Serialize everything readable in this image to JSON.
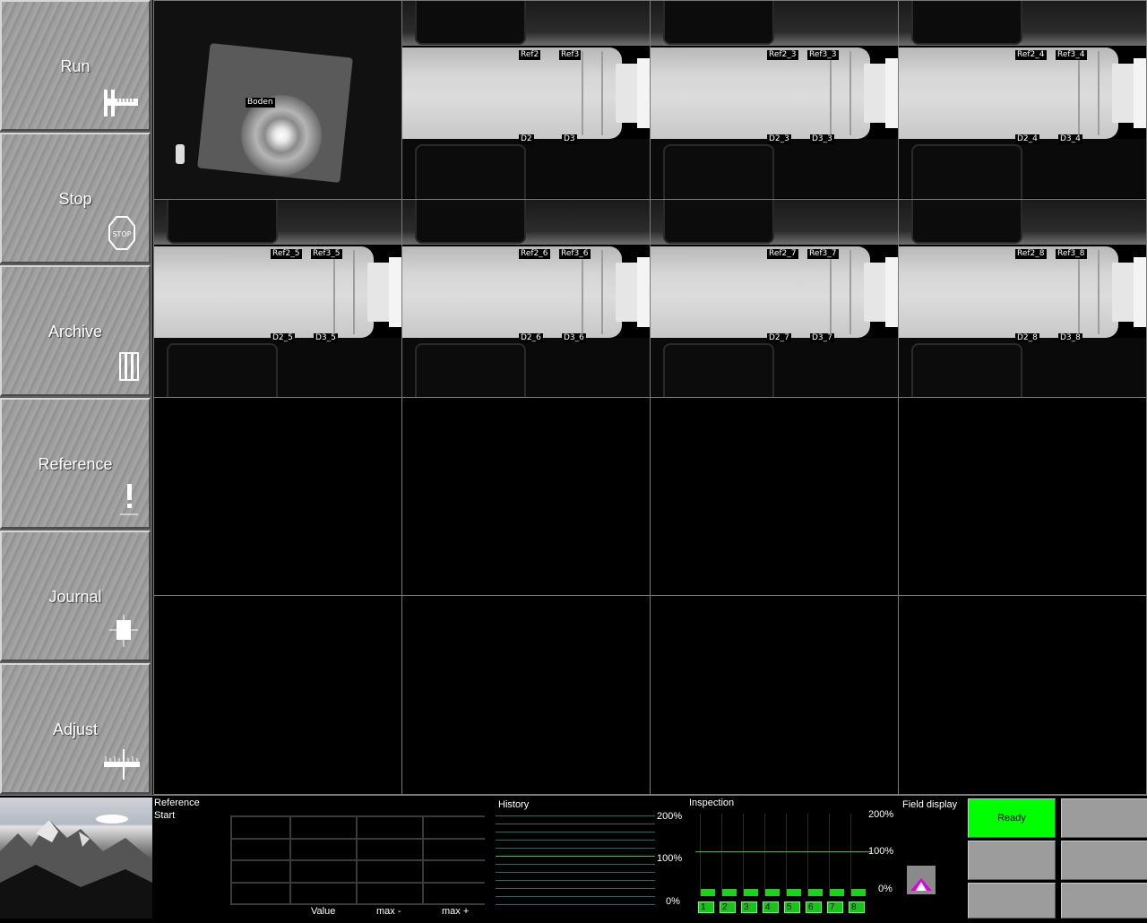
{
  "sidebar": {
    "items": [
      {
        "label": "Run",
        "icon": "caliper-icon"
      },
      {
        "label": "Stop",
        "icon": "stop-sign-icon"
      },
      {
        "label": "Archive",
        "icon": "archive-icon"
      },
      {
        "label": "Reference",
        "icon": "reference-exclamation-icon"
      },
      {
        "label": "Journal",
        "icon": "journal-icon"
      },
      {
        "label": "Adjust",
        "icon": "ruler-icon"
      }
    ]
  },
  "cameras": {
    "top_view_label": "Boden",
    "views": [
      {
        "ref2": "Ref2",
        "ref3": "Ref3",
        "d2": "D2",
        "d3": "D3"
      },
      {
        "ref2": "Ref2_3",
        "ref3": "Ref3_3",
        "d2": "D2_3",
        "d3": "D3_3"
      },
      {
        "ref2": "Ref2_4",
        "ref3": "Ref3_4",
        "d2": "D2_4",
        "d3": "D3_4"
      },
      {
        "ref2": "Ref2_5",
        "ref3": "Ref3_5",
        "d2": "D2_5",
        "d3": "D3_5"
      },
      {
        "ref2": "Ref2_6",
        "ref3": "Ref3_6",
        "d2": "D2_6",
        "d3": "D3_6"
      },
      {
        "ref2": "Ref2_7",
        "ref3": "Ref3_7",
        "d2": "D2_7",
        "d3": "D3_7"
      },
      {
        "ref2": "Ref2_8",
        "ref3": "Ref3_8",
        "d2": "D2_8",
        "d3": "D3_8"
      }
    ]
  },
  "bottom": {
    "reference_title": "Reference",
    "reference_status": "Start",
    "table_headers": [
      "Value",
      "max -",
      "max +"
    ],
    "history_title": "History",
    "history_scale": [
      "200%",
      "100%",
      "0%"
    ],
    "inspection_title": "Inspection",
    "inspection_scale": [
      "200%",
      "100%",
      "0%"
    ],
    "inspection_channels": [
      "1",
      "2",
      "3",
      "4",
      "5",
      "6",
      "7",
      "8"
    ],
    "field_display_title": "Field display",
    "ready_label": "Ready",
    "colors": {
      "ready": "#00ff00",
      "channel": "#1bc21b",
      "history_line": "#1d6b6b",
      "history_mid": "#22cc22"
    }
  }
}
